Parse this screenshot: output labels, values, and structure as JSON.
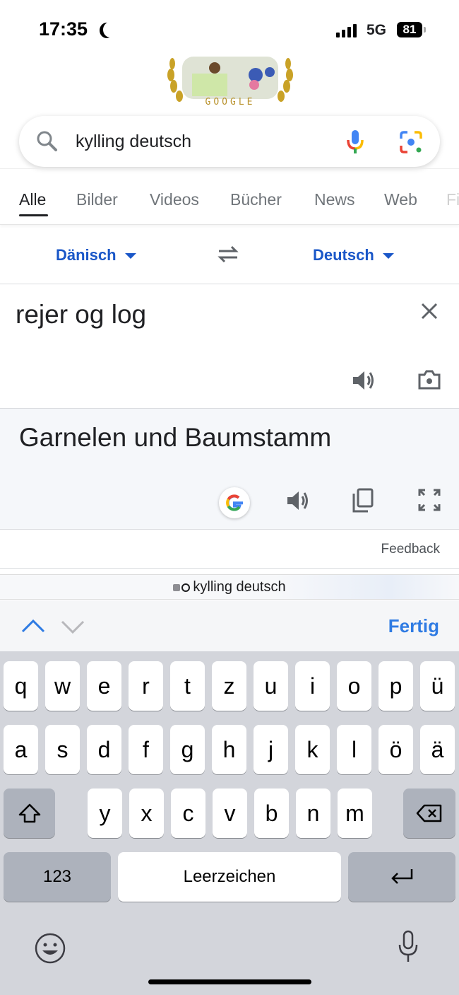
{
  "status_bar": {
    "time": "17:35",
    "network": "5G",
    "battery": "81"
  },
  "doodle": {
    "text": "GOOGLE"
  },
  "search": {
    "query": "kylling deutsch"
  },
  "tabs": [
    {
      "label": "Alle",
      "active": true
    },
    {
      "label": "Bilder"
    },
    {
      "label": "Videos"
    },
    {
      "label": "Bücher"
    },
    {
      "label": "News"
    },
    {
      "label": "Web"
    },
    {
      "label": "Fi"
    }
  ],
  "translate": {
    "source_lang": "Dänisch",
    "target_lang": "Deutsch",
    "source_text": "rejer og log",
    "translated_text": "Garnelen und Baumstamm",
    "feedback": "Feedback"
  },
  "browser": {
    "url_text": "kylling deutsch",
    "done_label": "Fertig"
  },
  "keyboard": {
    "row1": [
      "q",
      "w",
      "e",
      "r",
      "t",
      "z",
      "u",
      "i",
      "o",
      "p",
      "ü"
    ],
    "row2": [
      "a",
      "s",
      "d",
      "f",
      "g",
      "h",
      "j",
      "k",
      "l",
      "ö",
      "ä"
    ],
    "row3": [
      "y",
      "x",
      "c",
      "v",
      "b",
      "n",
      "m"
    ],
    "numbers_label": "123",
    "space_label": "Leerzeichen"
  },
  "colors": {
    "accent": "#1a57c8",
    "ios_blue": "#2f7be3",
    "keyboard_bg": "#d3d5db"
  }
}
